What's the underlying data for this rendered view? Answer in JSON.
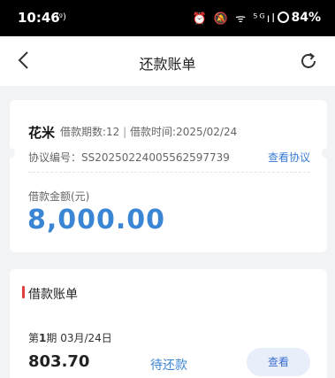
{
  "status_bar": {
    "time": "10:46",
    "hotspot": "(ᵍ)",
    "icons_text": "⏰ 🔕 ᯤ ⁵ᴳıl",
    "battery": "84%"
  },
  "nav": {
    "title": "还款账单"
  },
  "loan": {
    "name": "花米",
    "periods": "借款期数:12",
    "separator": "|",
    "borrow_time": "借款时间:2025/02/24",
    "contract_no": "协议编号：SS20250224005562597739",
    "view_contract": "查看协议",
    "amount_label": "借款金额(元)",
    "amount": "8,000.00"
  },
  "bill": {
    "section_title": "借款账单",
    "period_prefix": "第",
    "period_num": "1",
    "period_suffix": "期 03月/24日",
    "amount": "803.70",
    "status": "待还款",
    "view_label": "查看"
  },
  "colors": {
    "accent_blue": "#3a86d4",
    "red_bar": "#e0413a"
  }
}
